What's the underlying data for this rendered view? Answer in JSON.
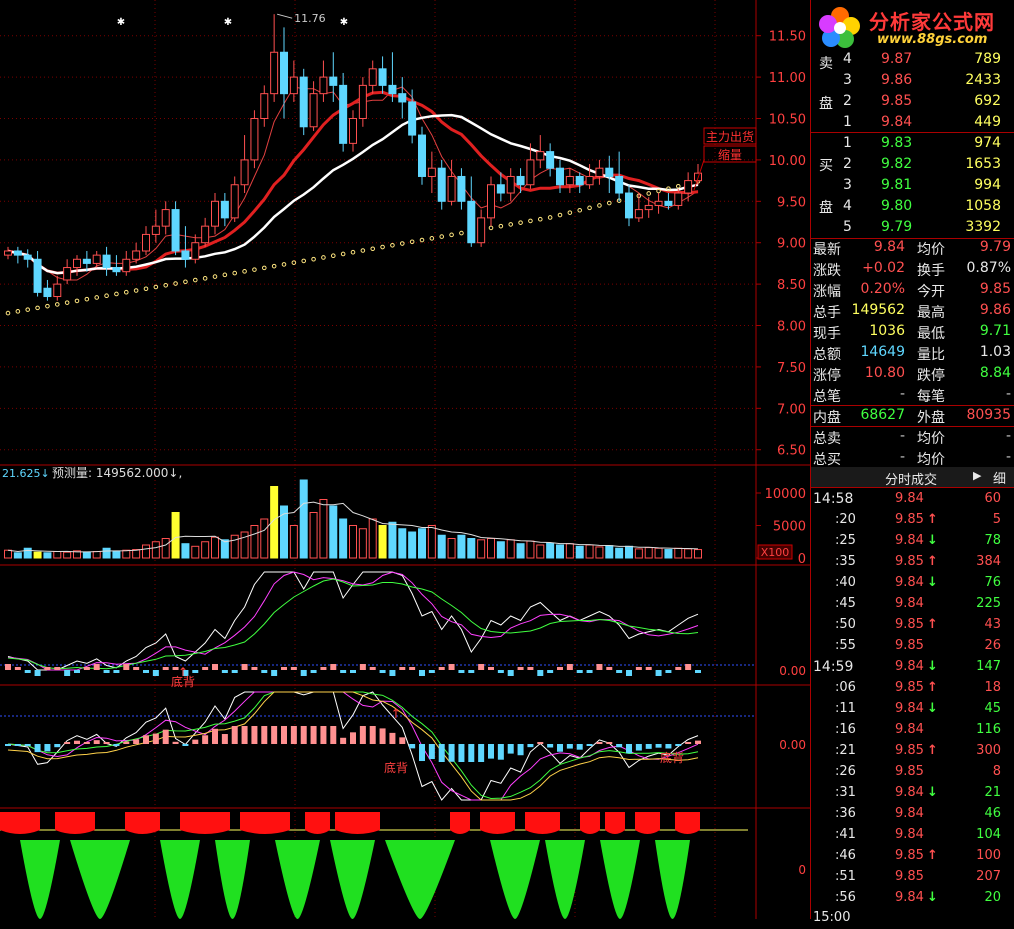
{
  "chart_data": {
    "type": "candlestick",
    "price_axis": {
      "ticks": [
        "11.50",
        "11.00",
        "10.50",
        "10.00",
        "9.50",
        "9.00",
        "8.50",
        "8.00",
        "7.50",
        "7.00",
        "6.50"
      ],
      "range": [
        6.4,
        11.75
      ]
    },
    "high_annotation": "11.76",
    "candles": [
      [
        8.85,
        8.9,
        8.8,
        8.95
      ],
      [
        8.9,
        8.85,
        8.75,
        8.95
      ],
      [
        8.85,
        8.8,
        8.7,
        8.92
      ],
      [
        8.8,
        8.4,
        8.35,
        8.9
      ],
      [
        8.45,
        8.35,
        8.3,
        8.55
      ],
      [
        8.35,
        8.5,
        8.3,
        8.6
      ],
      [
        8.55,
        8.7,
        8.5,
        8.8
      ],
      [
        8.7,
        8.8,
        8.6,
        8.85
      ],
      [
        8.8,
        8.75,
        8.65,
        8.9
      ],
      [
        8.75,
        8.85,
        8.7,
        8.9
      ],
      [
        8.85,
        8.7,
        8.6,
        8.95
      ],
      [
        8.7,
        8.65,
        8.6,
        8.85
      ],
      [
        8.65,
        8.8,
        8.6,
        8.9
      ],
      [
        8.8,
        8.9,
        8.75,
        9.0
      ],
      [
        8.9,
        9.1,
        8.85,
        9.2
      ],
      [
        9.1,
        9.2,
        9.0,
        9.4
      ],
      [
        9.2,
        9.4,
        9.1,
        9.5
      ],
      [
        9.4,
        8.9,
        8.85,
        9.5
      ],
      [
        8.9,
        8.8,
        8.7,
        9.2
      ],
      [
        8.8,
        9.0,
        8.75,
        9.1
      ],
      [
        9.0,
        9.2,
        8.95,
        9.3
      ],
      [
        9.2,
        9.5,
        9.1,
        9.6
      ],
      [
        9.5,
        9.3,
        9.2,
        9.6
      ],
      [
        9.3,
        9.7,
        9.25,
        9.8
      ],
      [
        9.7,
        10.0,
        9.6,
        10.3
      ],
      [
        10.0,
        10.5,
        9.9,
        10.6
      ],
      [
        10.5,
        10.8,
        10.4,
        10.9
      ],
      [
        10.8,
        11.3,
        10.7,
        11.76
      ],
      [
        11.3,
        10.8,
        10.5,
        11.6
      ],
      [
        10.8,
        11.0,
        10.7,
        11.2
      ],
      [
        11.0,
        10.4,
        10.3,
        11.1
      ],
      [
        10.4,
        10.8,
        10.35,
        10.95
      ],
      [
        10.8,
        11.0,
        10.7,
        11.2
      ],
      [
        11.0,
        10.9,
        10.7,
        11.3
      ],
      [
        10.9,
        10.2,
        10.1,
        11.05
      ],
      [
        10.2,
        10.5,
        10.1,
        10.6
      ],
      [
        10.5,
        10.9,
        10.4,
        11.0
      ],
      [
        10.9,
        11.1,
        10.8,
        11.2
      ],
      [
        11.1,
        10.9,
        10.8,
        11.25
      ],
      [
        10.9,
        10.8,
        10.7,
        11.3
      ],
      [
        10.8,
        10.7,
        10.5,
        11.0
      ],
      [
        10.7,
        10.3,
        10.2,
        10.85
      ],
      [
        10.3,
        9.8,
        9.7,
        10.4
      ],
      [
        9.8,
        9.9,
        9.6,
        10.1
      ],
      [
        9.9,
        9.5,
        9.4,
        10.0
      ],
      [
        9.5,
        9.8,
        9.45,
        10.0
      ],
      [
        9.8,
        9.5,
        9.4,
        9.9
      ],
      [
        9.5,
        9.0,
        8.95,
        9.8
      ],
      [
        9.0,
        9.3,
        8.95,
        9.4
      ],
      [
        9.3,
        9.7,
        9.2,
        9.8
      ],
      [
        9.7,
        9.6,
        9.5,
        9.85
      ],
      [
        9.6,
        9.8,
        9.5,
        9.9
      ],
      [
        9.8,
        9.7,
        9.6,
        9.9
      ],
      [
        9.7,
        10.0,
        9.65,
        10.2
      ],
      [
        10.0,
        10.1,
        9.9,
        10.3
      ],
      [
        10.1,
        9.9,
        9.8,
        10.2
      ],
      [
        9.9,
        9.7,
        9.6,
        10.0
      ],
      [
        9.7,
        9.8,
        9.6,
        9.9
      ],
      [
        9.8,
        9.7,
        9.6,
        9.85
      ],
      [
        9.7,
        9.8,
        9.65,
        9.95
      ],
      [
        9.8,
        9.9,
        9.7,
        10.0
      ],
      [
        9.9,
        9.8,
        9.6,
        10.05
      ],
      [
        9.8,
        9.6,
        9.5,
        10.1
      ],
      [
        9.6,
        9.3,
        9.2,
        9.7
      ],
      [
        9.3,
        9.4,
        9.25,
        9.6
      ],
      [
        9.4,
        9.45,
        9.3,
        9.55
      ],
      [
        9.45,
        9.5,
        9.35,
        9.6
      ],
      [
        9.5,
        9.45,
        9.4,
        9.6
      ],
      [
        9.45,
        9.6,
        9.4,
        9.65
      ],
      [
        9.6,
        9.75,
        9.5,
        9.85
      ],
      [
        9.75,
        9.84,
        9.7,
        9.95
      ]
    ],
    "sell_label": "主力出货",
    "shrink_label": "缩量",
    "volume_axis": {
      "ticks": [
        "10000",
        "5000",
        "0"
      ],
      "max": 12000
    },
    "volume_header_left": "21.625",
    "volume_header_text": "预测量: 149562.000",
    "volume_unit": "X100",
    "volume": [
      1200,
      800,
      1500,
      900,
      800,
      1000,
      900,
      1100,
      900,
      1000,
      1500,
      1000,
      1200,
      1300,
      2000,
      2500,
      3000,
      7000,
      2200,
      1800,
      2500,
      3200,
      2800,
      3500,
      4000,
      5000,
      6000,
      11000,
      8000,
      5000,
      12000,
      7000,
      9000,
      8000,
      6000,
      5000,
      4500,
      6000,
      5000,
      5500,
      4500,
      4000,
      4500,
      5000,
      3500,
      3000,
      3500,
      3000,
      2800,
      3000,
      2500,
      2800,
      2200,
      2600,
      2000,
      2300,
      2000,
      2200,
      1800,
      2000,
      1700,
      1900,
      1500,
      1800,
      1400,
      1600,
      1500,
      1300,
      1500,
      1400,
      1300
    ],
    "yellow_bars": [
      3,
      17,
      27,
      38
    ],
    "ind1_zero_label": "0.00",
    "ind1_bottom_label": "底背",
    "ind2_zero_label": "0.00",
    "ind2_bottom_label": "底背",
    "ind3_zero_label": "0"
  },
  "sidebar": {
    "logo_title": "分析家公式网",
    "logo_url": "www.88gs.com",
    "sell_side_label_1": "卖",
    "sell_side_label_2": "盘",
    "sell_rows": [
      {
        "n": "4",
        "price": "9.87",
        "vol": "789"
      },
      {
        "n": "3",
        "price": "9.86",
        "vol": "2433"
      },
      {
        "n": "2",
        "price": "9.85",
        "vol": "692"
      },
      {
        "n": "1",
        "price": "9.84",
        "vol": "449"
      }
    ],
    "buy_side_label_1": "买",
    "buy_side_label_2": "盘",
    "buy_rows": [
      {
        "n": "1",
        "price": "9.83",
        "vol": "974"
      },
      {
        "n": "2",
        "price": "9.82",
        "vol": "1653"
      },
      {
        "n": "3",
        "price": "9.81",
        "vol": "994"
      },
      {
        "n": "4",
        "price": "9.80",
        "vol": "1058"
      },
      {
        "n": "5",
        "price": "9.79",
        "vol": "3392"
      }
    ],
    "stats": [
      {
        "l1": "最新",
        "v1": "9.84",
        "c1": "up",
        "l2": "均价",
        "v2": "9.79",
        "c2": "up"
      },
      {
        "l1": "涨跌",
        "v1": "+0.02",
        "c1": "up",
        "l2": "换手",
        "v2": "0.87%",
        "c2": "wt"
      },
      {
        "l1": "涨幅",
        "v1": "0.20%",
        "c1": "up",
        "l2": "今开",
        "v2": "9.85",
        "c2": "up"
      },
      {
        "l1": "总手",
        "v1": "149562",
        "c1": "yl",
        "l2": "最高",
        "v2": "9.86",
        "c2": "up"
      },
      {
        "l1": "现手",
        "v1": "1036",
        "c1": "yl",
        "l2": "最低",
        "v2": "9.71",
        "c2": "dn"
      },
      {
        "l1": "总额",
        "v1": "14649",
        "c1": "cy",
        "l2": "量比",
        "v2": "1.03",
        "c2": "wt"
      },
      {
        "l1": "涨停",
        "v1": "10.80",
        "c1": "up",
        "l2": "跌停",
        "v2": "8.84",
        "c2": "dn"
      },
      {
        "l1": "总笔",
        "v1": "-",
        "c1": "gr",
        "l2": "每笔",
        "v2": "-",
        "c2": "gr"
      },
      {
        "l1": "内盘",
        "v1": "68627",
        "c1": "dn",
        "l2": "外盘",
        "v2": "80935",
        "c2": "up"
      },
      {
        "l1": "总卖",
        "v1": "-",
        "c1": "gr",
        "l2": "均价",
        "v2": "-",
        "c2": "gr"
      },
      {
        "l1": "总买",
        "v1": "-",
        "c1": "gr",
        "l2": "均价",
        "v2": "-",
        "c2": "gr"
      }
    ],
    "ticks_header": "分时成交",
    "ticks_header_arrow": "▶",
    "ticks_header_detail": "细",
    "ticks": [
      {
        "t": "14:58",
        "p": "9.84",
        "pc": "up",
        "a": "",
        "v": "60",
        "vc": "up",
        "big": true
      },
      {
        "t": ":20",
        "p": "9.85",
        "pc": "up",
        "a": "up",
        "v": "5",
        "vc": "up"
      },
      {
        "t": ":25",
        "p": "9.84",
        "pc": "up",
        "a": "dn",
        "v": "78",
        "vc": "dn"
      },
      {
        "t": ":35",
        "p": "9.85",
        "pc": "up",
        "a": "up",
        "v": "384",
        "vc": "up"
      },
      {
        "t": ":40",
        "p": "9.84",
        "pc": "up",
        "a": "dn",
        "v": "76",
        "vc": "dn"
      },
      {
        "t": ":45",
        "p": "9.84",
        "pc": "up",
        "a": "",
        "v": "225",
        "vc": "dn"
      },
      {
        "t": ":50",
        "p": "9.85",
        "pc": "up",
        "a": "up",
        "v": "43",
        "vc": "up"
      },
      {
        "t": ":55",
        "p": "9.85",
        "pc": "up",
        "a": "",
        "v": "26",
        "vc": "up"
      },
      {
        "t": "14:59",
        "p": "9.84",
        "pc": "up",
        "a": "dn",
        "v": "147",
        "vc": "dn",
        "big": true
      },
      {
        "t": ":06",
        "p": "9.85",
        "pc": "up",
        "a": "up",
        "v": "18",
        "vc": "up"
      },
      {
        "t": ":11",
        "p": "9.84",
        "pc": "up",
        "a": "dn",
        "v": "45",
        "vc": "dn"
      },
      {
        "t": ":16",
        "p": "9.84",
        "pc": "up",
        "a": "",
        "v": "116",
        "vc": "dn"
      },
      {
        "t": ":21",
        "p": "9.85",
        "pc": "up",
        "a": "up",
        "v": "300",
        "vc": "up"
      },
      {
        "t": ":26",
        "p": "9.85",
        "pc": "up",
        "a": "",
        "v": "8",
        "vc": "up"
      },
      {
        "t": ":31",
        "p": "9.84",
        "pc": "up",
        "a": "dn",
        "v": "21",
        "vc": "dn"
      },
      {
        "t": ":36",
        "p": "9.84",
        "pc": "up",
        "a": "",
        "v": "46",
        "vc": "dn"
      },
      {
        "t": ":41",
        "p": "9.84",
        "pc": "up",
        "a": "",
        "v": "104",
        "vc": "dn"
      },
      {
        "t": ":46",
        "p": "9.85",
        "pc": "up",
        "a": "up",
        "v": "100",
        "vc": "up"
      },
      {
        "t": ":51",
        "p": "9.85",
        "pc": "up",
        "a": "",
        "v": "207",
        "vc": "up"
      },
      {
        "t": ":56",
        "p": "9.84",
        "pc": "up",
        "a": "dn",
        "v": "20",
        "vc": "dn"
      }
    ],
    "bottom_time": "15:00"
  },
  "colors": {
    "up": "#ff5050",
    "down": "#5fd7ff",
    "grid": "#7a0000",
    "ma_red": "#e02020",
    "ma_white": "#ffffff"
  }
}
